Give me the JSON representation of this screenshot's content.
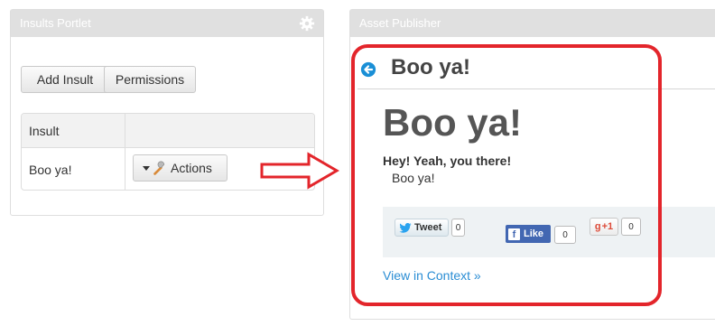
{
  "left_portlet": {
    "title": "Insults Portlet",
    "add_button": "Add Insult",
    "permissions_button": "Permissions",
    "table": {
      "headers": [
        "Insult",
        ""
      ],
      "rows": [
        {
          "insult": "Boo ya!",
          "action_label": "Actions"
        }
      ]
    }
  },
  "right_portlet": {
    "title": "Asset Publisher",
    "header_title": "Boo ya!",
    "article_title": "Boo ya!",
    "summary": "Hey! Yeah, you there!",
    "body": "Boo ya!",
    "social": {
      "tweet_label": "Tweet",
      "tweet_count": "0",
      "like_label": "Like",
      "like_count": "0",
      "gplus_label": "+1",
      "gplus_count": "0"
    },
    "context_link": "View in Context »"
  },
  "colors": {
    "title_bar": "#e0e0e0",
    "link": "#2a8dd4",
    "highlight_frame": "#e3252b",
    "facebook": "#4267b2"
  }
}
